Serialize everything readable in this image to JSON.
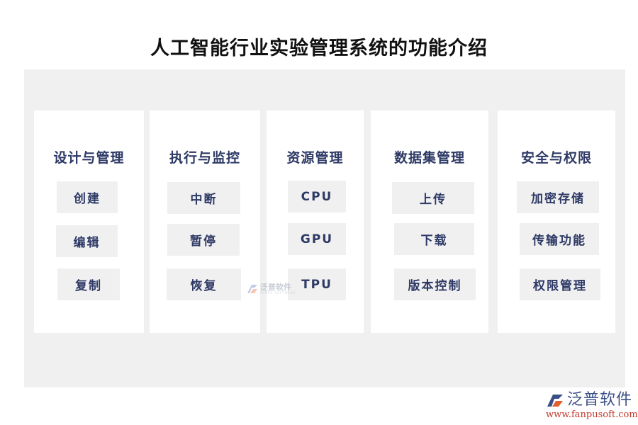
{
  "title": "人工智能行业实验管理系统的功能介绍",
  "colors": {
    "panel_bg": "#f0f0f0",
    "card_bg": "#ffffff",
    "text_accent": "#2e3a66",
    "title_text": "#111111",
    "logo_blue": "#3a4f85",
    "logo_url_red": "#c0392b"
  },
  "cards": [
    {
      "title": "设计与管理",
      "items": [
        "创建",
        "编辑",
        "复制"
      ]
    },
    {
      "title": "执行与监控",
      "items": [
        "中断",
        "暂停",
        "恢复"
      ]
    },
    {
      "title": "资源管理",
      "items": [
        "CPU",
        "GPU",
        "TPU"
      ]
    },
    {
      "title": "数据集管理",
      "items": [
        "上传",
        "下载",
        "版本控制"
      ]
    },
    {
      "title": "安全与权限",
      "items": [
        "加密存储",
        "传输功能",
        "权限管理"
      ]
    }
  ],
  "watermark": {
    "name": "泛普软件",
    "sub": "FANPU SOFTWARE",
    "icon": "fanpu-logo-icon"
  },
  "logo": {
    "name": "泛普软件",
    "url": "www.fanpusoft.com",
    "icon": "fanpu-logo-icon"
  }
}
